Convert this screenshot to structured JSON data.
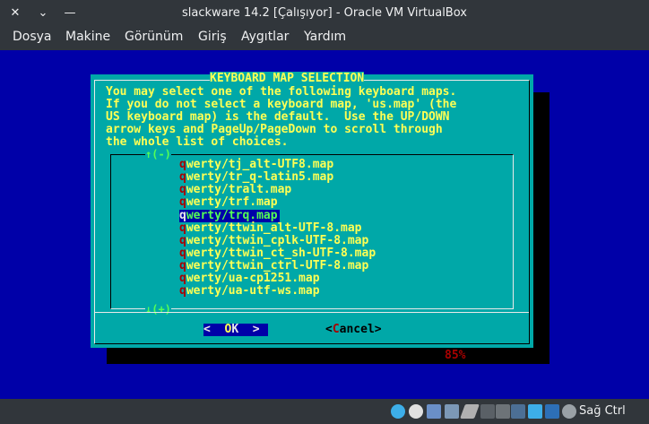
{
  "window": {
    "title": "slackware 14.2 [Çalışıyor] - Oracle VM VirtualBox",
    "close_glyph": "✕",
    "minimize_glyph": "⌄",
    "restore_glyph": "—"
  },
  "menubar": {
    "items": [
      "Dosya",
      "Makine",
      "Görünüm",
      "Giriş",
      "Aygıtlar",
      "Yardım"
    ]
  },
  "dialog": {
    "title": "KEYBOARD MAP SELECTION",
    "description": "You may select one of the following keyboard maps.\nIf you do not select a keyboard map, 'us.map' (the\nUS keyboard map) is the default.  Use the UP/DOWN\narrow keys and PageUp/PageDown to scroll through\nthe whole list of choices.",
    "scroll_up": "↑(-)",
    "scroll_down": "↓(+)",
    "percent": "85%",
    "items": [
      {
        "hotkey": "q",
        "rest": "werty/tj_alt-UTF8.map"
      },
      {
        "hotkey": "q",
        "rest": "werty/tr_q-latin5.map"
      },
      {
        "hotkey": "q",
        "rest": "werty/tralt.map"
      },
      {
        "hotkey": "q",
        "rest": "werty/trf.map"
      },
      {
        "hotkey": "q",
        "rest": "werty/trq.map"
      },
      {
        "hotkey": "q",
        "rest": "werty/ttwin_alt-UTF-8.map"
      },
      {
        "hotkey": "q",
        "rest": "werty/ttwin_cplk-UTF-8.map"
      },
      {
        "hotkey": "q",
        "rest": "werty/ttwin_ct_sh-UTF-8.map"
      },
      {
        "hotkey": "q",
        "rest": "werty/ttwin_ctrl-UTF-8.map"
      },
      {
        "hotkey": "q",
        "rest": "werty/ua-cp1251.map"
      },
      {
        "hotkey": "q",
        "rest": "werty/ua-utf-ws.map"
      }
    ],
    "selected_index": 4,
    "ok": {
      "left": "<  ",
      "hotkey": "O",
      "rest": "K",
      "right": "  >"
    },
    "cancel": {
      "left": "<",
      "hotkey": "C",
      "rest": "ancel",
      "right": ">"
    }
  },
  "statusbar": {
    "host_key_label": "Sağ Ctrl",
    "icons": [
      "optical-drive-icon",
      "audio-icon",
      "network-icon",
      "usb-icon",
      "pen-icon",
      "shared-folder-icon",
      "display-icon",
      "recording-icon",
      "screen-capture-icon",
      "cpu-icon",
      "mouse-icon",
      "down-arrow-icon"
    ]
  },
  "colors": {
    "vm_background": "#0000a8",
    "dialog": "#00a8a8",
    "text_yellow": "#ffff54",
    "hotkey_red": "#a80000",
    "scroll_green": "#54ff54"
  }
}
